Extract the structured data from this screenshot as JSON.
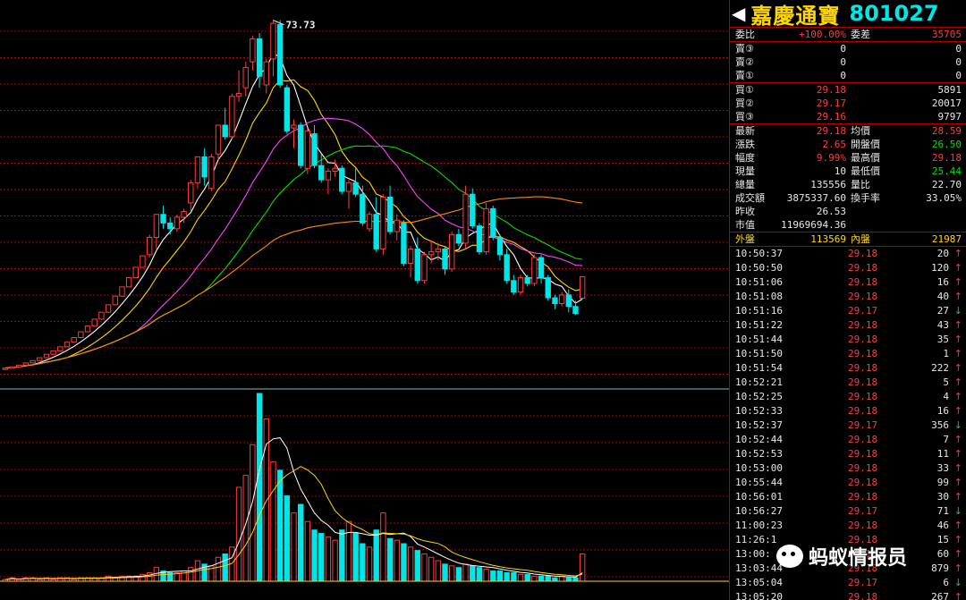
{
  "header": {
    "name": "嘉慶通寶",
    "code": "801027",
    "prev_arrow": "◀",
    "next_arrow": "▶"
  },
  "order_ratio": {
    "label1": "委比",
    "value1": "+100.00%",
    "label2": "委差",
    "value2": "35705"
  },
  "asks": [
    {
      "label": "賣③",
      "price": "0",
      "vol": "0"
    },
    {
      "label": "賣②",
      "price": "0",
      "vol": "0"
    },
    {
      "label": "賣①",
      "price": "0",
      "vol": "0"
    }
  ],
  "bids": [
    {
      "label": "買①",
      "price": "29.18",
      "vol": "5891"
    },
    {
      "label": "買②",
      "price": "29.17",
      "vol": "20017"
    },
    {
      "label": "買③",
      "price": "29.16",
      "vol": "9797"
    }
  ],
  "quote": [
    {
      "l1": "最新",
      "v1": "29.18",
      "c1": "red",
      "l2": "均價",
      "v2": "28.59",
      "c2": "red"
    },
    {
      "l1": "漲跌",
      "v1": "2.65",
      "c1": "red",
      "l2": "開盤價",
      "v2": "26.50",
      "c2": "grn"
    },
    {
      "l1": "幅度",
      "v1": "9.99%",
      "c1": "red",
      "l2": "最高價",
      "v2": "29.18",
      "c2": "red"
    },
    {
      "l1": "現量",
      "v1": "10",
      "c1": "wht",
      "l2": "最低價",
      "v2": "25.44",
      "c2": "grn"
    },
    {
      "l1": "總量",
      "v1": "135556",
      "c1": "wht",
      "l2": "量比",
      "v2": "22.70",
      "c2": "wht"
    },
    {
      "l1": "成交額",
      "v1": "3875337.60",
      "c1": "wht",
      "l2": "換手率",
      "v2": "33.05%",
      "c2": "wht"
    },
    {
      "l1": "昨收",
      "v1": "26.53",
      "c1": "wht",
      "l2": "",
      "v2": "",
      "c2": "wht"
    },
    {
      "l1": "市值",
      "v1": "11969694.36",
      "c1": "wht",
      "l2": "",
      "v2": "",
      "c2": "wht"
    }
  ],
  "outer_inner": {
    "l1": "外盤",
    "v1": "113569",
    "l2": "內盤",
    "v2": "21987"
  },
  "ticks": [
    {
      "time": "10:50:37",
      "price": "29.18",
      "vol": "20",
      "dir": "↑",
      "c": "red"
    },
    {
      "time": "10:50:50",
      "price": "29.18",
      "vol": "120",
      "dir": "↑",
      "c": "red"
    },
    {
      "time": "10:51:06",
      "price": "29.18",
      "vol": "16",
      "dir": "↑",
      "c": "red"
    },
    {
      "time": "10:51:08",
      "price": "29.18",
      "vol": "40",
      "dir": "↑",
      "c": "red"
    },
    {
      "time": "10:51:16",
      "price": "29.17",
      "vol": "27",
      "dir": "↓",
      "c": "grn"
    },
    {
      "time": "10:51:22",
      "price": "29.18",
      "vol": "43",
      "dir": "↑",
      "c": "red"
    },
    {
      "time": "10:51:44",
      "price": "29.18",
      "vol": "35",
      "dir": "↑",
      "c": "red"
    },
    {
      "time": "10:51:50",
      "price": "29.18",
      "vol": "1",
      "dir": "↑",
      "c": "red"
    },
    {
      "time": "10:51:54",
      "price": "29.18",
      "vol": "222",
      "dir": "↑",
      "c": "red"
    },
    {
      "time": "10:52:21",
      "price": "29.18",
      "vol": "5",
      "dir": "↑",
      "c": "red"
    },
    {
      "time": "10:52:25",
      "price": "29.18",
      "vol": "4",
      "dir": "↑",
      "c": "red"
    },
    {
      "time": "10:52:33",
      "price": "29.18",
      "vol": "16",
      "dir": "↑",
      "c": "red"
    },
    {
      "time": "10:52:37",
      "price": "29.17",
      "vol": "356",
      "dir": "↓",
      "c": "grn"
    },
    {
      "time": "10:52:44",
      "price": "29.18",
      "vol": "7",
      "dir": "↑",
      "c": "red"
    },
    {
      "time": "10:52:53",
      "price": "29.18",
      "vol": "11",
      "dir": "↑",
      "c": "red"
    },
    {
      "time": "10:53:00",
      "price": "29.18",
      "vol": "33",
      "dir": "↑",
      "c": "red"
    },
    {
      "time": "10:55:44",
      "price": "29.18",
      "vol": "99",
      "dir": "↑",
      "c": "red"
    },
    {
      "time": "10:56:01",
      "price": "29.18",
      "vol": "30",
      "dir": "↑",
      "c": "red"
    },
    {
      "time": "10:56:27",
      "price": "29.17",
      "vol": "71",
      "dir": "↓",
      "c": "grn"
    },
    {
      "time": "11:00:23",
      "price": "29.18",
      "vol": "46",
      "dir": "↑",
      "c": "red"
    },
    {
      "time": "11:26:1",
      "price": "29.18",
      "vol": "15",
      "dir": "↑",
      "c": "red"
    },
    {
      "time": "13:00:",
      "price": "29.18",
      "vol": "60",
      "dir": "↑",
      "c": "red"
    },
    {
      "time": "13:03:44",
      "price": "29.18",
      "vol": "879",
      "dir": "↑",
      "c": "red"
    },
    {
      "time": "13:05:04",
      "price": "29.17",
      "vol": "6",
      "dir": "↓",
      "c": "grn"
    },
    {
      "time": "13:05:20",
      "price": "29.18",
      "vol": "267",
      "dir": "↑",
      "c": "red"
    }
  ],
  "watermark": {
    "text": "蚂蚁情报员"
  },
  "colors": {
    "up": "#ff3c3c",
    "down": "#00e5e5",
    "grid": "#b00000",
    "ma5": "#ffffff",
    "ma10": "#ffd700",
    "ma20": "#ff40ff",
    "ma30": "#00e000",
    "ma60": "#ff8c00"
  },
  "chart_data": {
    "type": "candlestick",
    "peak_label": "73.73",
    "ylim": [
      12,
      76
    ],
    "candles": [
      [
        13.1,
        13.4,
        12.9,
        13.3
      ],
      [
        13.3,
        13.5,
        13.2,
        13.5
      ],
      [
        13.5,
        13.8,
        13.4,
        13.8
      ],
      [
        13.8,
        14.2,
        13.7,
        14.2
      ],
      [
        14.2,
        14.6,
        14.1,
        14.6
      ],
      [
        14.6,
        15.1,
        14.5,
        15.1
      ],
      [
        15.1,
        15.7,
        15.0,
        15.7
      ],
      [
        15.7,
        16.3,
        15.6,
        16.3
      ],
      [
        16.3,
        17.0,
        16.2,
        17.0
      ],
      [
        17.0,
        17.8,
        16.9,
        17.8
      ],
      [
        17.8,
        18.6,
        17.7,
        18.6
      ],
      [
        18.6,
        19.6,
        18.5,
        19.6
      ],
      [
        19.6,
        20.6,
        19.5,
        20.6
      ],
      [
        20.6,
        21.8,
        20.5,
        21.8
      ],
      [
        21.8,
        23.0,
        21.7,
        23.0
      ],
      [
        23.0,
        24.3,
        22.9,
        24.3
      ],
      [
        24.3,
        25.8,
        24.2,
        25.8
      ],
      [
        25.8,
        27.4,
        25.7,
        27.4
      ],
      [
        27.4,
        29.0,
        27.3,
        29.0
      ],
      [
        29.0,
        30.8,
        28.9,
        30.8
      ],
      [
        30.8,
        32.8,
        30.7,
        32.8
      ],
      [
        33.0,
        36.5,
        32.5,
        36.0
      ],
      [
        36.0,
        40.0,
        34.0,
        40.0
      ],
      [
        40.0,
        41.5,
        37.5,
        38.5
      ],
      [
        38.5,
        39.5,
        36.5,
        37.5
      ],
      [
        37.5,
        40.0,
        37.0,
        39.5
      ],
      [
        39.5,
        41.0,
        38.5,
        40.5
      ],
      [
        42.0,
        46.0,
        40.5,
        45.5
      ],
      [
        45.5,
        50.0,
        44.5,
        50.0
      ],
      [
        50.0,
        51.5,
        45.0,
        46.5
      ],
      [
        44.5,
        50.5,
        44.0,
        50.0
      ],
      [
        50.5,
        55.5,
        49.5,
        55.5
      ],
      [
        55.5,
        58.5,
        53.0,
        53.5
      ],
      [
        53.5,
        61.0,
        53.0,
        60.5
      ],
      [
        60.5,
        65.0,
        59.5,
        61.0
      ],
      [
        62.0,
        66.5,
        60.5,
        65.5
      ],
      [
        66.5,
        71.0,
        65.0,
        70.5
      ],
      [
        70.5,
        71.5,
        62.0,
        64.0
      ],
      [
        62.5,
        67.0,
        61.0,
        66.5
      ],
      [
        67.0,
        73.73,
        64.0,
        73.2
      ],
      [
        73.0,
        73.73,
        62.0,
        62.5
      ],
      [
        62.0,
        62.5,
        54.0,
        54.5
      ],
      [
        55.0,
        56.5,
        51.5,
        55.5
      ],
      [
        55.5,
        56.0,
        48.0,
        48.5
      ],
      [
        48.0,
        55.0,
        47.0,
        54.5
      ],
      [
        54.0,
        55.5,
        48.0,
        48.5
      ],
      [
        48.5,
        50.5,
        45.5,
        46.0
      ],
      [
        46.0,
        48.0,
        43.5,
        47.5
      ],
      [
        47.5,
        49.5,
        46.5,
        48.0
      ],
      [
        48.0,
        48.5,
        43.5,
        44.0
      ],
      [
        44.0,
        46.0,
        41.0,
        45.5
      ],
      [
        45.5,
        48.0,
        43.0,
        43.5
      ],
      [
        43.5,
        45.0,
        38.0,
        38.5
      ],
      [
        37.5,
        40.5,
        37.0,
        40.0
      ],
      [
        40.0,
        43.0,
        33.5,
        34.0
      ],
      [
        34.0,
        43.5,
        33.0,
        43.0
      ],
      [
        43.0,
        45.0,
        36.5,
        37.0
      ],
      [
        37.0,
        40.0,
        35.5,
        39.0
      ],
      [
        38.5,
        39.0,
        31.0,
        31.5
      ],
      [
        31.5,
        34.5,
        29.0,
        34.0
      ],
      [
        34.0,
        36.0,
        28.0,
        28.5
      ],
      [
        28.5,
        33.5,
        28.0,
        33.0
      ],
      [
        33.0,
        35.5,
        31.5,
        33.5
      ],
      [
        33.5,
        35.0,
        32.0,
        34.0
      ],
      [
        34.0,
        34.5,
        29.5,
        30.5
      ],
      [
        30.5,
        37.0,
        30.0,
        36.5
      ],
      [
        36.5,
        37.5,
        34.5,
        35.0
      ],
      [
        35.0,
        45.0,
        34.0,
        43.5
      ],
      [
        43.5,
        44.5,
        37.5,
        38.0
      ],
      [
        38.0,
        38.5,
        33.0,
        33.5
      ],
      [
        33.5,
        42.0,
        33.0,
        41.0
      ],
      [
        41.0,
        41.5,
        35.5,
        36.0
      ],
      [
        36.0,
        36.5,
        32.0,
        33.0
      ],
      [
        33.0,
        34.0,
        28.0,
        28.5
      ],
      [
        28.5,
        29.5,
        26.0,
        26.5
      ],
      [
        26.5,
        29.5,
        26.0,
        29.0
      ],
      [
        29.0,
        29.5,
        27.5,
        28.0
      ],
      [
        28.0,
        33.0,
        27.5,
        32.5
      ],
      [
        32.5,
        33.0,
        28.0,
        29.0
      ],
      [
        29.0,
        29.5,
        25.0,
        25.5
      ],
      [
        25.5,
        26.0,
        23.5,
        24.5
      ],
      [
        24.5,
        26.5,
        24.0,
        26.0
      ],
      [
        26.0,
        27.0,
        23.0,
        24.0
      ],
      [
        24.0,
        25.0,
        22.5,
        22.8
      ],
      [
        25.44,
        29.18,
        25.44,
        29.18
      ]
    ],
    "volumes": [
      1,
      2,
      1,
      2,
      2,
      1,
      2,
      1,
      2,
      2,
      1,
      2,
      2,
      2,
      2,
      3,
      2,
      3,
      3,
      3,
      4,
      5,
      8,
      6,
      5,
      5,
      6,
      8,
      12,
      10,
      9,
      14,
      16,
      20,
      55,
      62,
      80,
      110,
      95,
      70,
      65,
      50,
      40,
      45,
      35,
      30,
      28,
      26,
      24,
      30,
      35,
      28,
      22,
      20,
      30,
      40,
      25,
      24,
      22,
      20,
      18,
      16,
      14,
      12,
      10,
      9,
      8,
      10,
      9,
      8,
      7,
      6,
      6,
      5,
      5,
      4,
      4,
      3,
      3,
      3,
      2,
      3,
      2,
      2,
      16
    ]
  }
}
